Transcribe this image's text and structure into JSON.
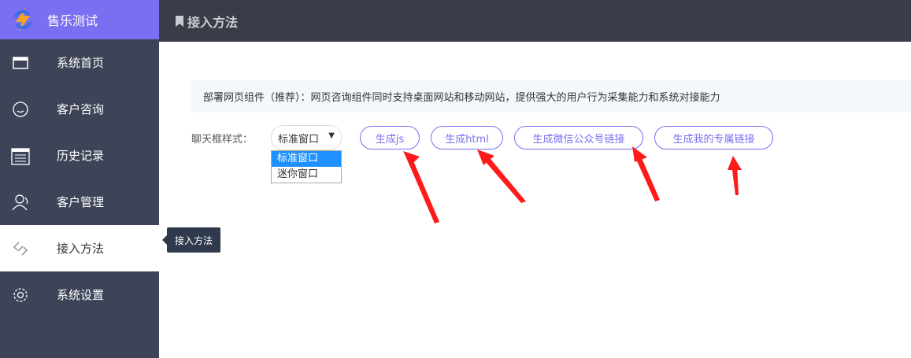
{
  "app": {
    "title": "售乐测试"
  },
  "sidebar": {
    "items": [
      {
        "label": "系统首页",
        "icon": "window-icon"
      },
      {
        "label": "客户咨询",
        "icon": "smile-icon"
      },
      {
        "label": "历史记录",
        "icon": "calendar-icon"
      },
      {
        "label": "客户管理",
        "icon": "user-icon"
      },
      {
        "label": "接入方法",
        "icon": "link-icon",
        "active": true
      },
      {
        "label": "系统设置",
        "icon": "gear-icon"
      }
    ],
    "tooltip": "接入方法"
  },
  "header": {
    "title": "接入方法"
  },
  "notice": "部署网页组件（推荐）：网页咨询组件同时支持桌面网站和移动网站，提供强大的用户行为采集能力和系统对接能力",
  "form": {
    "style_label": "聊天框样式：",
    "select_value": "标准窗口",
    "options": [
      "标准窗口",
      "迷你窗口"
    ]
  },
  "buttons": {
    "js": "生成js",
    "html": "生成html",
    "wechat": "生成微信公众号链接",
    "exclusive": "生成我的专属链接"
  },
  "colors": {
    "accent": "#7a6ff0",
    "sidebar": "#3d4457",
    "topbar": "#393d48",
    "arrow": "#ff1a1a"
  }
}
